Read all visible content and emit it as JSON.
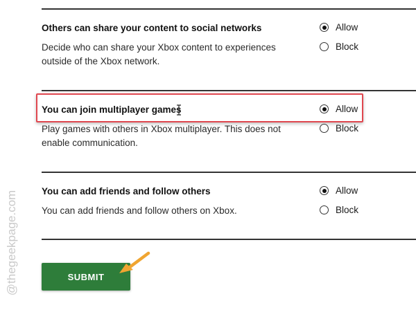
{
  "settings": [
    {
      "title": "Others can share your content to social networks",
      "description": "Decide who can share your Xbox content to experiences outside of the Xbox network.",
      "options": [
        "Allow",
        "Block"
      ],
      "selected": "Allow"
    },
    {
      "title": "You can join multiplayer games",
      "description": "Play games with others in Xbox multiplayer. This does not enable communication.",
      "options": [
        "Allow",
        "Block"
      ],
      "selected": "Allow"
    },
    {
      "title": "You can add friends and follow others",
      "description": "You can add friends and follow others on Xbox.",
      "options": [
        "Allow",
        "Block"
      ],
      "selected": "Allow"
    }
  ],
  "submit_label": "SUBMIT",
  "watermark": "@thegeekpage.com",
  "colors": {
    "submit_bg": "#2e7d3a",
    "highlight_border": "#e0474f",
    "arrow": "#f0a531"
  },
  "icons": {
    "cursor": "text-cursor-icon",
    "arrow": "annotation-arrow-icon"
  }
}
